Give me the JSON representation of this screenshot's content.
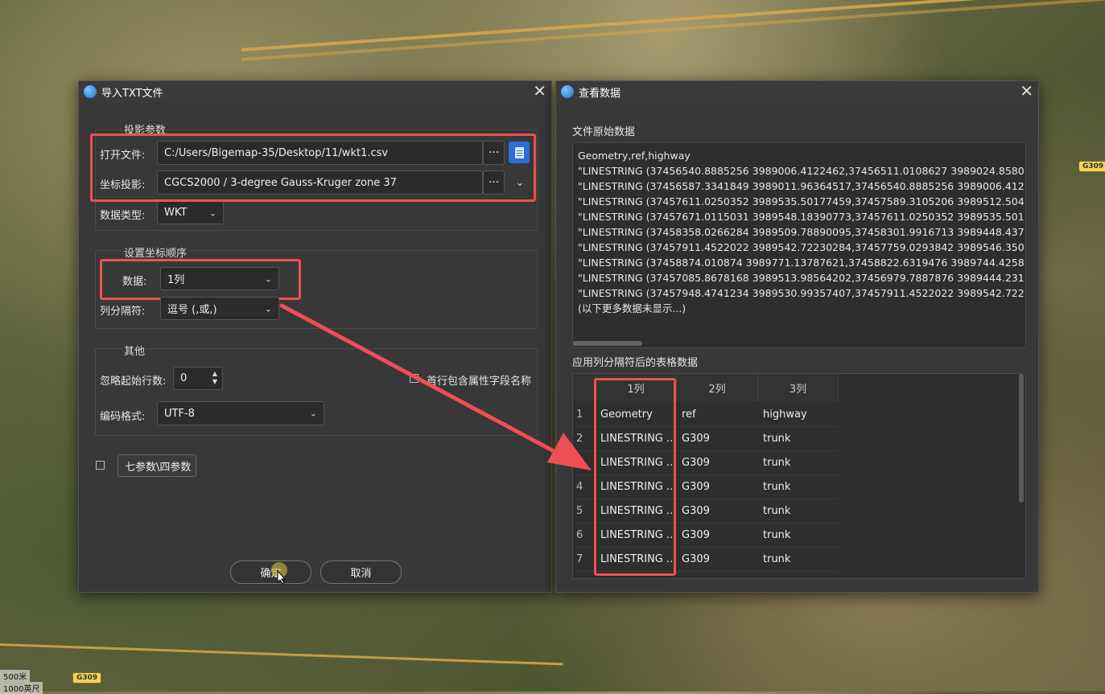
{
  "map": {
    "road_shields": [
      "G309",
      "G309"
    ],
    "scale_labels": [
      "500米",
      "1000英尺"
    ]
  },
  "import_dialog": {
    "title": "导入TXT文件",
    "projection_group_title": "投影参数",
    "open_file_label": "打开文件:",
    "open_file_value": "C:/Users/Bigemap-35/Desktop/11/wkt1.csv",
    "coord_label": "坐标投影:",
    "coord_value": "CGCS2000 / 3-degree Gauss-Kruger zone 37",
    "data_type_label": "数据类型:",
    "data_type_value": "WKT",
    "order_group_title": "设置坐标顺序",
    "data_label": "数据:",
    "data_value": "1列",
    "separator_label": "列分隔符:",
    "separator_value": "逗号 (,或,)",
    "other_group_title": "其他",
    "skip_label": "忽略起始行数:",
    "skip_value": "0",
    "header_checkbox_label": "首行包含属性字段名称",
    "encoding_label": "编码格式:",
    "encoding_value": "UTF-8",
    "seven_params_label": "七参数\\四参数",
    "ok_label": "确定",
    "cancel_label": "取消",
    "dots": "···",
    "chevron": "⌄"
  },
  "view_dialog": {
    "title": "查看数据",
    "raw_title": "文件原始数据",
    "raw_lines": [
      "Geometry,ref,highway",
      "\"LINESTRING (37456540.8885256 3989006.4122462,37456511.0108627 3989024.8580",
      "\"LINESTRING (37456587.3341849 3989011.96364517,37456540.8885256 3989006.412",
      "\"LINESTRING (37457611.0250352 3989535.50177459,37457589.3105206 3989512.504",
      "\"LINESTRING (37457671.0115031 3989548.18390773,37457611.0250352 3989535.501",
      "\"LINESTRING (37458358.0266284 3989509.78890095,37458301.9916713 3989448.437",
      "\"LINESTRING (37457911.4522022 3989542.72230284,37457759.0293842 3989546.350",
      "\"LINESTRING (37458874.010874 3989771.13787621,37458822.6319476 3989744.4258",
      "\"LINESTRING (37457085.8678168 3989513.98564202,37456979.7887876 3989444.231",
      "\"LINESTRING (37457948.4741234 3989530.99357407,37457911.4522022 3989542.722",
      "(以下更多数据未显示...)"
    ],
    "table_title": "应用列分隔符后的表格数据",
    "columns": [
      "1列",
      "2列",
      "3列"
    ],
    "rows": [
      [
        "1",
        "Geometry",
        "ref",
        "highway"
      ],
      [
        "2",
        "LINESTRING ...",
        "G309",
        "trunk"
      ],
      [
        "3",
        "LINESTRING ...",
        "G309",
        "trunk"
      ],
      [
        "4",
        "LINESTRING ...",
        "G309",
        "trunk"
      ],
      [
        "5",
        "LINESTRING ...",
        "G309",
        "trunk"
      ],
      [
        "6",
        "LINESTRING ...",
        "G309",
        "trunk"
      ],
      [
        "7",
        "LINESTRING ...",
        "G309",
        "trunk"
      ]
    ]
  },
  "colors": {
    "highlight": "#ef4e55",
    "dialog_bg": "#383838",
    "accent": "#1a6fd0"
  }
}
